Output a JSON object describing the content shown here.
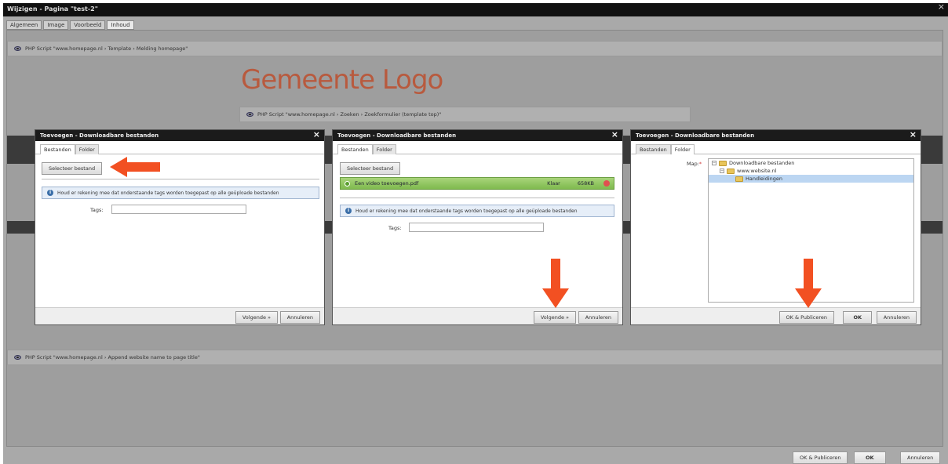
{
  "window": {
    "title": "Wijzigen - Pagina \"test-2\"",
    "close": "×"
  },
  "tabs": [
    "Algemeen",
    "Image",
    "Voorbeeld",
    "Inhoud"
  ],
  "bars": {
    "top": "PHP Script \"www.homepage.nl › Template › Melding homepage\"",
    "search": "PHP Script \"www.homepage.nl ›  Zoeken › Zoekformulier (template top)\"",
    "bottom": "PHP Script \"www.homepage.nl › Append website name to page title\""
  },
  "logo": "Gemeente Logo",
  "dialog": {
    "title": "Toevoegen - Downloadbare bestanden",
    "close": "×",
    "tabs": [
      "Bestanden",
      "Folder"
    ],
    "select_label": "Selecteer bestand",
    "info": "Houd er rekening mee dat onderstaande tags worden toegepast op alle geüploade bestanden",
    "tags_label": "Tags:",
    "next": "Volgende »",
    "cancel": "Annuleren"
  },
  "upload": {
    "file": "Een video toevoegen.pdf",
    "status": "Klaar",
    "size": "658KB"
  },
  "folder": {
    "map_label": "Map:",
    "required": "*",
    "tree": [
      "Downloadbare bestanden",
      "www.website.nl",
      "Handleidingen"
    ],
    "ok_publish": "OK & Publiceren",
    "ok": "OK",
    "cancel": "Annuleren"
  },
  "footer": {
    "ok_publish": "OK & Publiceren",
    "ok": "OK",
    "cancel": "Annuleren"
  },
  "colors": {
    "arrow": "#f25022",
    "upload_green": "#8bc34a",
    "selection": "#bcd6f2"
  }
}
